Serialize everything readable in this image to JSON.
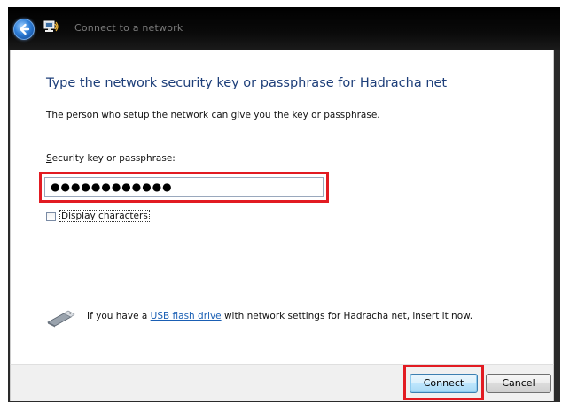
{
  "window": {
    "title": "Connect to a network"
  },
  "heading": "Type the network security key or passphrase for Hadracha net",
  "description": "The person who setup the network can give you the key or passphrase.",
  "security_field": {
    "label_underlined": "S",
    "label_rest": "ecurity key or passphrase:",
    "value": "●●●●●●●●●●●●"
  },
  "display_characters": {
    "label_underlined": "D",
    "label_rest": "isplay characters",
    "checked": false
  },
  "usb": {
    "prefix": "If you have a ",
    "link": "USB flash drive",
    "suffix": " with network settings for Hadracha net, insert it now."
  },
  "buttons": {
    "connect": "Connect",
    "cancel": "Cancel"
  },
  "colors": {
    "highlight": "#e21b22",
    "heading": "#1e3f7a",
    "link": "#1a5fb4"
  }
}
